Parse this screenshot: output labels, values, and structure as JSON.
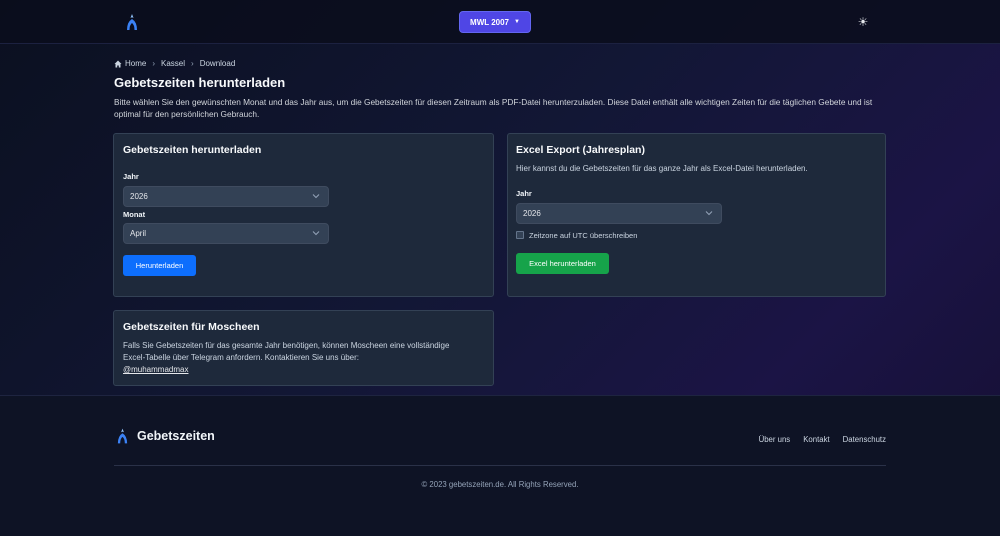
{
  "nav": {
    "method_label": "MWL 2007",
    "theme_icon": "sun-icon"
  },
  "breadcrumb": {
    "home": "Home",
    "city": "Kassel",
    "current": "Download"
  },
  "page": {
    "title": "Gebetszeiten herunterladen",
    "intro": "Bitte wählen Sie den gewünschten Monat und das Jahr aus, um die Gebetszeiten für diesen Zeitraum als PDF-Datei herunterzuladen. Diese Datei enthält alle wichtigen Zeiten für die täglichen Gebete und ist optimal für den persönlichen Gebrauch."
  },
  "download_card": {
    "title": "Gebetszeiten herunterladen",
    "year_label": "Jahr",
    "year_value": "2026",
    "month_label": "Monat",
    "month_value": "April",
    "button": "Herunterladen"
  },
  "excel_card": {
    "title": "Excel Export (Jahresplan)",
    "description": "Hier kannst du die Gebetszeiten für das ganze Jahr als Excel-Datei herunterladen.",
    "year_label": "Jahr",
    "year_value": "2026",
    "utc_label": "Zeitzone auf UTC überschreiben",
    "utc_checked": false,
    "button": "Excel herunterladen"
  },
  "mosque_card": {
    "title": "Gebetszeiten für Moscheen",
    "text": "Falls Sie Gebetszeiten für das gesamte Jahr benötigen, können Moscheen eine vollständige Excel-Tabelle über Telegram anfordern. Kontaktieren Sie uns über:",
    "handle": "@muhammadmax"
  },
  "footer": {
    "brand": "Gebetszeiten",
    "links": [
      "Über uns",
      "Kontakt",
      "Datenschutz"
    ],
    "copyright": "© 2023 gebetszeiten.de. All Rights Reserved."
  },
  "colors": {
    "accent": "#4f46e5",
    "primary_button": "#0d6efd",
    "success_button": "#16a34a",
    "card_bg": "#1e293b"
  }
}
